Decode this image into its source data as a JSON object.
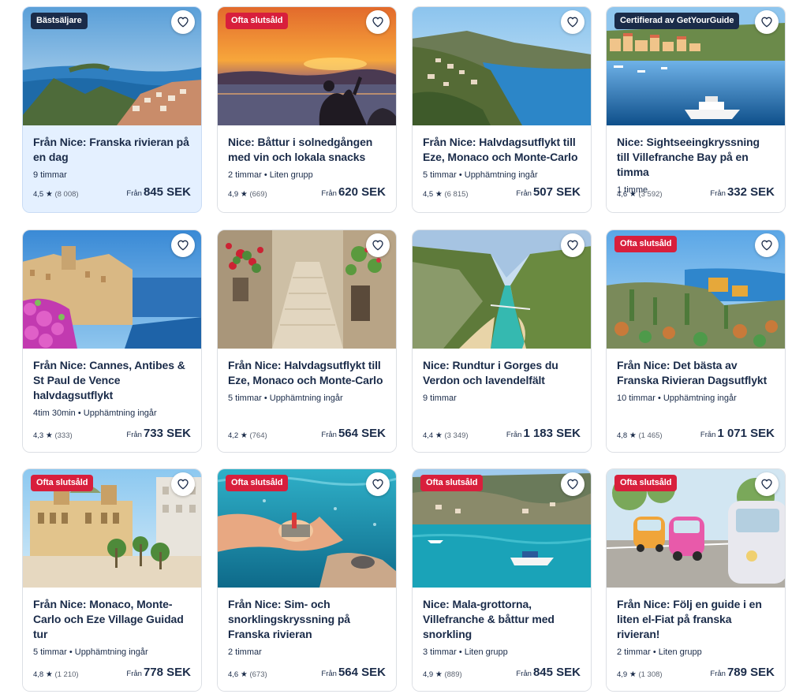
{
  "cards": [
    {
      "badge": "Bästsäljare",
      "badge_color": "#1a2b49",
      "title": "Från Nice: Franska rivieran på en dag",
      "meta": "9 timmar",
      "rating": "4,5",
      "reviews": "(8 008)",
      "from": "Från",
      "price": "845 SEK",
      "highlight": true,
      "scene": "coast-bay"
    },
    {
      "badge": "Ofta slutsåld",
      "badge_color": "#d81f3c",
      "title": "Nice: Båttur i solnedgången med vin och lokala snacks",
      "meta": "2 timmar • Liten grupp",
      "rating": "4,9",
      "reviews": "(669)",
      "from": "Från",
      "price": "620 SEK",
      "scene": "sunset"
    },
    {
      "badge": "",
      "title": "Från Nice: Halvdagsutflykt till Eze, Monaco och Monte-Carlo",
      "meta": "5 timmar • Upphämtning ingår",
      "rating": "4,5",
      "reviews": "(6 815)",
      "from": "Från",
      "price": "507 SEK",
      "scene": "hill-coast"
    },
    {
      "badge": "Certifierad av GetYourGuide",
      "badge_color": "#1a2b49",
      "title": "Nice: Sightseeingkryssning till Villefranche Bay på en timma",
      "meta": "1 timme",
      "rating": "4,6",
      "reviews": "(3 592)",
      "from": "Från",
      "price": "332 SEK",
      "scene": "harbor-boat"
    },
    {
      "badge": "",
      "title": "Från Nice: Cannes, Antibes & St Paul de Vence halvdagsutflykt",
      "meta": "4tim 30min • Upphämtning ingår",
      "rating": "4,3",
      "reviews": "(333)",
      "from": "Från",
      "price": "733 SEK",
      "scene": "old-town-flowers"
    },
    {
      "badge": "",
      "title": "Från Nice: Halvdagsutflykt till Eze, Monaco och Monte-Carlo",
      "meta": "5 timmar • Upphämtning ingår",
      "rating": "4,2",
      "reviews": "(764)",
      "from": "Från",
      "price": "564 SEK",
      "scene": "stone-alley"
    },
    {
      "badge": "",
      "title": "Nice: Rundtur i Gorges du Verdon och lavendelfält",
      "meta": "9 timmar",
      "rating": "4,4",
      "reviews": "(3 349)",
      "from": "Från",
      "price": "1 183 SEK",
      "scene": "gorge"
    },
    {
      "badge": "Ofta slutsåld",
      "badge_color": "#d81f3c",
      "title": "Från Nice: Det bästa av Franska Rivieran Dagsutflykt",
      "meta": "10 timmar • Upphämtning ingår",
      "rating": "4,8",
      "reviews": "(1 465)",
      "from": "Från",
      "price": "1 071 SEK",
      "scene": "garden-coast"
    },
    {
      "badge": "Ofta slutsåld",
      "badge_color": "#d81f3c",
      "title": "Från Nice: Monaco, Monte-Carlo och Eze Village Guidad tur",
      "meta": "5 timmar • Upphämtning ingår",
      "rating": "4,8",
      "reviews": "(1 210)",
      "from": "Från",
      "price": "778 SEK",
      "scene": "casino"
    },
    {
      "badge": "Ofta slutsåld",
      "badge_color": "#d81f3c",
      "title": "Från Nice: Sim- och snorklingskryssning på Franska rivieran",
      "meta": "2 timmar",
      "rating": "4,6",
      "reviews": "(673)",
      "from": "Från",
      "price": "564 SEK",
      "scene": "underwater"
    },
    {
      "badge": "Ofta slutsåld",
      "badge_color": "#d81f3c",
      "title": "Nice: Mala-grottorna, Villefranche & båttur med snorkling",
      "meta": "3 timmar • Liten grupp",
      "rating": "4,9",
      "reviews": "(889)",
      "from": "Från",
      "price": "845 SEK",
      "scene": "cove-boat"
    },
    {
      "badge": "Ofta slutsåld",
      "badge_color": "#d81f3c",
      "title": "Från Nice: Följ en guide i en liten el-Fiat på franska rivieran!",
      "meta": "2 timmar • Liten grupp",
      "rating": "4,9",
      "reviews": "(1 308)",
      "from": "Från",
      "price": "789 SEK",
      "scene": "small-cars"
    }
  ],
  "icons": {
    "wishlist": "heart-outline-icon",
    "rating": "star-icon"
  },
  "colors": {
    "accent_dark": "#1a2b49",
    "sold_out_red": "#d81f3c",
    "highlight_bg": "#e4f0ff"
  }
}
